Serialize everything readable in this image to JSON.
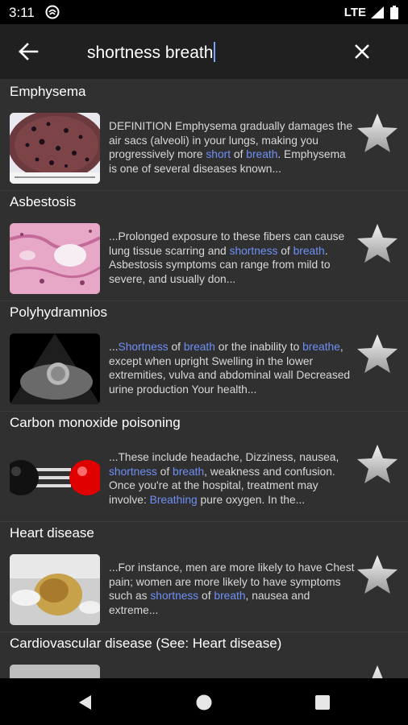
{
  "status_bar": {
    "time": "3:11",
    "network": "LTE"
  },
  "search": {
    "query": "shortness breath"
  },
  "results": [
    {
      "title": "Emphysema",
      "snippet": "DEFINITION Emphysema gradually damages the air sacs (alveoli) in your lungs, making you progressively more short of breath. Emphysema is one of several diseases known..."
    },
    {
      "title": "Asbestosis",
      "snippet": "...Prolonged exposure to these fibers can cause lung tissue scarring and shortness of breath. Asbestosis symptoms can range from mild to severe, and usually don..."
    },
    {
      "title": "Polyhydramnios",
      "snippet": "...Shortness of breath or the inability to breathe, except when upright Swelling in the lower extremities, vulva and abdominal wall Decreased urine production Your health..."
    },
    {
      "title": "Carbon monoxide poisoning",
      "snippet": "...These include headache, Dizziness, nausea, shortness of breath, weakness and confusion. Once you're at the hospital, treatment may involve: Breathing pure oxygen. In the..."
    },
    {
      "title": "Heart disease",
      "snippet": "...For instance, men are more likely to have Chest pain; women are more likely to have symptoms such as shortness of breath, nausea and extreme..."
    },
    {
      "title": "Cardiovascular disease (See: Heart disease)",
      "snippet": ""
    }
  ],
  "highlight_terms": [
    "short",
    "shortness",
    "breath",
    "breathe",
    "breathing"
  ],
  "colors": {
    "highlight": "#6f8ff7",
    "background": "#303030",
    "toolbar": "#202020"
  },
  "icons": {
    "back": "arrow-left-icon",
    "clear": "close-icon",
    "star": "star-icon",
    "nav": [
      "nav-back-icon",
      "nav-home-icon",
      "nav-recents-icon"
    ]
  }
}
